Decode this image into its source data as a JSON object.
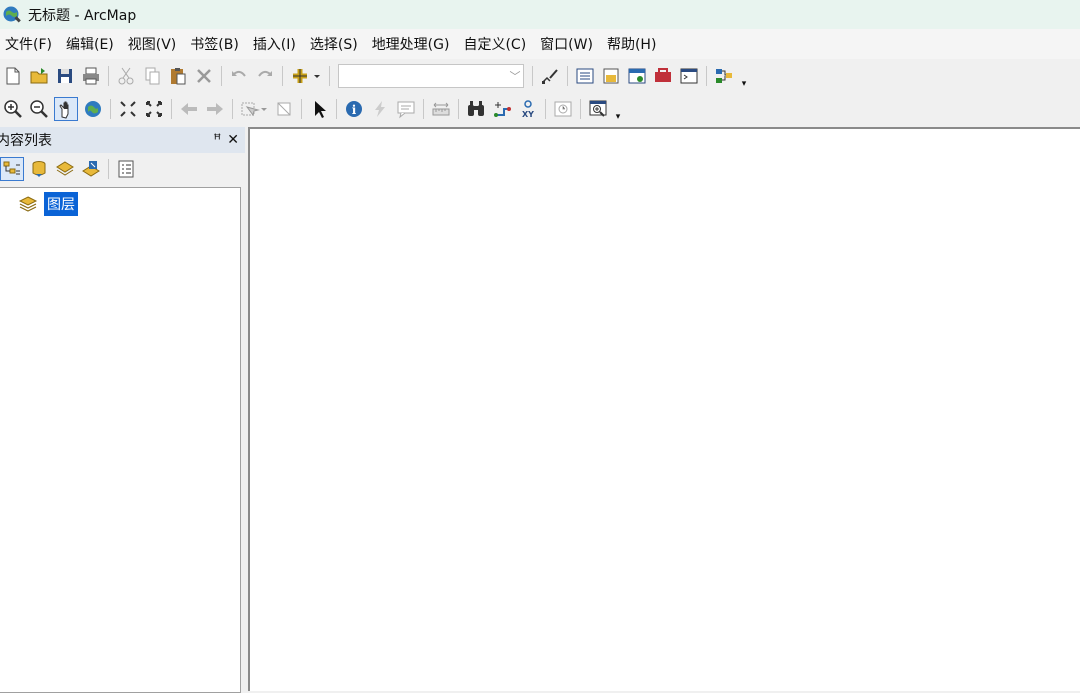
{
  "window": {
    "title": "无标题 - ArcMap"
  },
  "menu": [
    "文件(F)",
    "编辑(E)",
    "视图(V)",
    "书签(B)",
    "插入(I)",
    "选择(S)",
    "地理处理(G)",
    "自定义(C)",
    "窗口(W)",
    "帮助(H)"
  ],
  "toolbar": {
    "scale_combo_value": ""
  },
  "toc": {
    "title": "内容列表",
    "pin_glyph": "ꟸ",
    "close_glyph": "✕",
    "layer_root": "图层"
  }
}
